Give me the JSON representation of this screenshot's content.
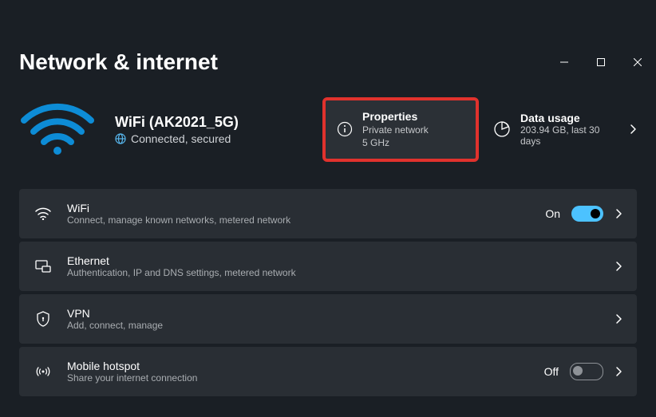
{
  "page_title": "Network & internet",
  "connection": {
    "name": "WiFi (AK2021_5G)",
    "status": "Connected, secured"
  },
  "properties_card": {
    "title": "Properties",
    "line1": "Private network",
    "line2": "5 GHz"
  },
  "usage_card": {
    "title": "Data usage",
    "subtitle": "203.94 GB, last 30 days"
  },
  "rows": {
    "wifi": {
      "title": "WiFi",
      "sub": "Connect, manage known networks, metered network",
      "toggle_label": "On",
      "toggle_on": true
    },
    "ethernet": {
      "title": "Ethernet",
      "sub": "Authentication, IP and DNS settings, metered network"
    },
    "vpn": {
      "title": "VPN",
      "sub": "Add, connect, manage"
    },
    "hotspot": {
      "title": "Mobile hotspot",
      "sub": "Share your internet connection",
      "toggle_label": "Off",
      "toggle_on": false
    }
  }
}
